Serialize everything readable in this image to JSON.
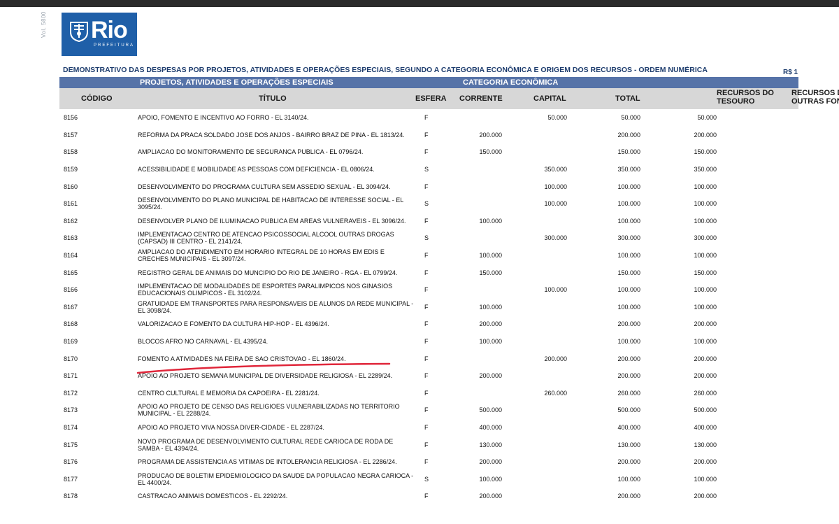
{
  "side_text": "Vol. 5800",
  "logo": {
    "name": "Rio",
    "subtitle": "PREFEITURA"
  },
  "title": "DEMONSTRATIVO DAS DESPESAS POR PROJETOS, ATIVIDADES E OPERAÇÕES ESPECIAIS, SEGUNDO A CATEGORIA ECONÔMICA E ORIGEM DOS RECURSOS - ORDEM NUMÉRICA",
  "currency": "R$ 1",
  "group_headers": {
    "projects": "PROJETOS, ATIVIDADES E OPERAÇÕES ESPECIAIS",
    "category": "CATEGORIA ECONÔMICA"
  },
  "columns": {
    "codigo": "CÓDIGO",
    "titulo": "TÍTULO",
    "esfera": "ESFERA",
    "corrente": "CORRENTE",
    "capital": "CAPITAL",
    "total": "TOTAL",
    "tesouro_1": "RECURSOS DO",
    "tesouro_2": "TESOURO",
    "outras_1": "RECURSOS DE",
    "outras_2": "OUTRAS FONTES"
  },
  "rows": [
    {
      "codigo": "8156",
      "titulo": "APOIO, FOMENTO E INCENTIVO AO FORRO - EL 3140/24.",
      "esfera": "F",
      "corrente": "",
      "capital": "50.000",
      "total": "50.000",
      "tesouro": "50.000"
    },
    {
      "codigo": "8157",
      "titulo": "REFORMA DA PRACA SOLDADO JOSE DOS ANJOS - BAIRRO BRAZ DE PINA - EL 1813/24.",
      "esfera": "F",
      "corrente": "200.000",
      "capital": "",
      "total": "200.000",
      "tesouro": "200.000"
    },
    {
      "codigo": "8158",
      "titulo": "AMPLIACAO DO MONITORAMENTO DE SEGURANCA PUBLICA - EL 0796/24.",
      "esfera": "F",
      "corrente": "150.000",
      "capital": "",
      "total": "150.000",
      "tesouro": "150.000"
    },
    {
      "codigo": "8159",
      "titulo": "ACESSIBILIDADE E MOBILIDADE AS PESSOAS COM DEFICIENCIA - EL 0806/24.",
      "esfera": "S",
      "corrente": "",
      "capital": "350.000",
      "total": "350.000",
      "tesouro": "350.000"
    },
    {
      "codigo": "8160",
      "titulo": "DESENVOLVIMENTO DO PROGRAMA CULTURA SEM ASSEDIO SEXUAL  - EL 3094/24.",
      "esfera": "F",
      "corrente": "",
      "capital": "100.000",
      "total": "100.000",
      "tesouro": "100.000"
    },
    {
      "codigo": "8161",
      "titulo": "DESENVOLVIMENTO DO PLANO MUNICIPAL DE HABITACAO DE INTERESSE SOCIAL - EL 3095/24.",
      "esfera": "S",
      "corrente": "",
      "capital": "100.000",
      "total": "100.000",
      "tesouro": "100.000"
    },
    {
      "codigo": "8162",
      "titulo": "DESENVOLVER PLANO DE ILUMINACAO PUBLICA EM AREAS VULNERAVEIS - EL 3096/24.",
      "esfera": "F",
      "corrente": "100.000",
      "capital": "",
      "total": "100.000",
      "tesouro": "100.000"
    },
    {
      "codigo": "8163",
      "titulo": "IMPLEMENTACAO CENTRO DE ATENCAO PSICOSSOCIAL ALCOOL OUTRAS DROGAS (CAPSAD) III CENTRO - EL 2141/24.",
      "esfera": "S",
      "corrente": "",
      "capital": "300.000",
      "total": "300.000",
      "tesouro": "300.000"
    },
    {
      "codigo": "8164",
      "titulo": "AMPLIACAO DO ATENDIMENTO EM HORARIO INTEGRAL DE 10 HORAS EM EDIS E CRECHES MUNICIPAIS  - EL 3097/24.",
      "esfera": "F",
      "corrente": "100.000",
      "capital": "",
      "total": "100.000",
      "tesouro": "100.000"
    },
    {
      "codigo": "8165",
      "titulo": "REGISTRO GERAL DE ANIMAIS DO MUNCIPIO DO RIO DE JANEIRO - RGA - EL 0799/24.",
      "esfera": "F",
      "corrente": "150.000",
      "capital": "",
      "total": "150.000",
      "tesouro": "150.000"
    },
    {
      "codigo": "8166",
      "titulo": "IMPLEMENTACAO DE MODALIDADES DE ESPORTES PARALIMPICOS NOS GINASIOS EDUCACIONAIS OLIMPICOS - EL 3102/24.",
      "esfera": "F",
      "corrente": "",
      "capital": "100.000",
      "total": "100.000",
      "tesouro": "100.000"
    },
    {
      "codigo": "8167",
      "titulo": "GRATUIDADE EM TRANSPORTES PARA RESPONSAVEIS DE ALUNOS DA REDE MUNICIPAL - EL 3098/24.",
      "esfera": "F",
      "corrente": "100.000",
      "capital": "",
      "total": "100.000",
      "tesouro": "100.000"
    },
    {
      "codigo": "8168",
      "titulo": "VALORIZACAO E FOMENTO DA CULTURA HIP-HOP - EL 4396/24.",
      "esfera": "F",
      "corrente": "200.000",
      "capital": "",
      "total": "200.000",
      "tesouro": "200.000"
    },
    {
      "codigo": "8169",
      "titulo": "BLOCOS AFRO NO CARNAVAL - EL 4395/24.",
      "esfera": "F",
      "corrente": "100.000",
      "capital": "",
      "total": "100.000",
      "tesouro": "100.000"
    },
    {
      "codigo": "8170",
      "titulo": "FOMENTO A ATIVIDADES NA FEIRA DE SAO CRISTOVAO - EL 1860/24.",
      "esfera": "F",
      "corrente": "",
      "capital": "200.000",
      "total": "200.000",
      "tesouro": "200.000"
    },
    {
      "codigo": "8171",
      "titulo": "APOIO AO PROJETO SEMANA MUNICIPAL DE DIVERSIDADE RELIGIOSA - EL 2289/24.",
      "esfera": "F",
      "corrente": "200.000",
      "capital": "",
      "total": "200.000",
      "tesouro": "200.000"
    },
    {
      "codigo": "8172",
      "titulo": "CENTRO CULTURAL E MEMORIA DA CAPOEIRA - EL 2281/24.",
      "esfera": "F",
      "corrente": "",
      "capital": "260.000",
      "total": "260.000",
      "tesouro": "260.000"
    },
    {
      "codigo": "8173",
      "titulo": "APOIO AO PROJETO DE CENSO DAS RELIGIOES VULNERABILIZADAS NO TERRITORIO MUNICIPAL - EL 2288/24.",
      "esfera": "F",
      "corrente": "500.000",
      "capital": "",
      "total": "500.000",
      "tesouro": "500.000"
    },
    {
      "codigo": "8174",
      "titulo": "APOIO AO PROJETO VIVA NOSSA DIVER-CIDADE - EL 2287/24.",
      "esfera": "F",
      "corrente": "400.000",
      "capital": "",
      "total": "400.000",
      "tesouro": "400.000"
    },
    {
      "codigo": "8175",
      "titulo": "NOVO PROGRAMA DE DESENVOLVIMENTO CULTURAL REDE CARIOCA DE RODA DE SAMBA - EL 4394/24.",
      "esfera": "F",
      "corrente": "130.000",
      "capital": "",
      "total": "130.000",
      "tesouro": "130.000"
    },
    {
      "codigo": "8176",
      "titulo": "PROGRAMA DE ASSISTENCIA AS VITIMAS DE INTOLERANCIA RELIGIOSA - EL 2286/24.",
      "esfera": "F",
      "corrente": "200.000",
      "capital": "",
      "total": "200.000",
      "tesouro": "200.000"
    },
    {
      "codigo": "8177",
      "titulo": "PRODUCAO DE BOLETIM EPIDEMIOLOGICO DA SAUDE DA POPULACAO NEGRA CARIOCA - EL 4400/24.",
      "esfera": "S",
      "corrente": "100.000",
      "capital": "",
      "total": "100.000",
      "tesouro": "100.000"
    },
    {
      "codigo": "8178",
      "titulo": "CASTRACAO ANIMAIS DOMESTICOS - EL 2292/24.",
      "esfera": "F",
      "corrente": "200.000",
      "capital": "",
      "total": "200.000",
      "tesouro": "200.000"
    }
  ],
  "colors": {
    "header_blue": "#5673a8",
    "title_blue": "#1e3d6e",
    "logo_blue": "#1f5fa8",
    "underline_red": "#e0263a"
  }
}
